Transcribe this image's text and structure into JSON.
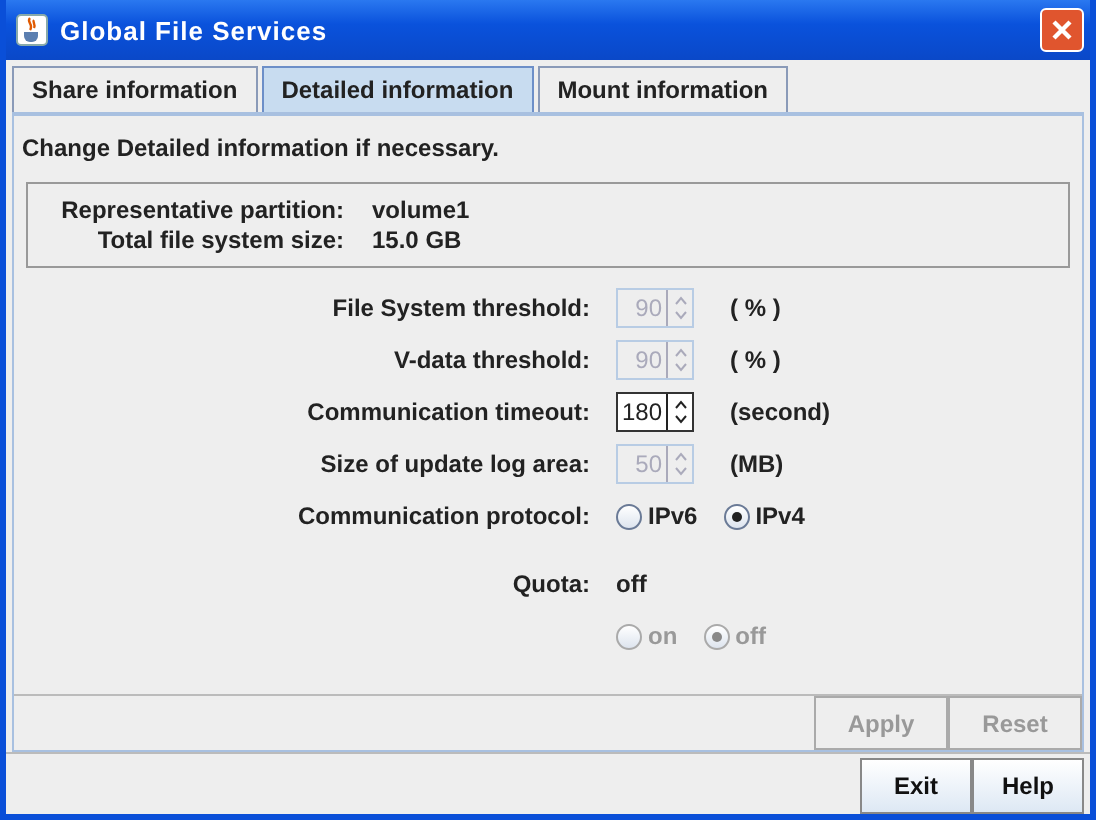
{
  "window": {
    "title": "Global File Services"
  },
  "tabs": [
    {
      "label": "Share information",
      "selected": false
    },
    {
      "label": "Detailed information",
      "selected": true
    },
    {
      "label": "Mount information",
      "selected": false
    }
  ],
  "instruction": "Change Detailed information if necessary.",
  "summary": [
    {
      "label": "Representative partition:",
      "value": "volume1"
    },
    {
      "label": "Total file system size:",
      "value": "15.0 GB"
    }
  ],
  "settings": [
    {
      "kind": "spinner",
      "label": "File System threshold:",
      "value": "90",
      "unit": "( % )",
      "disabled": true
    },
    {
      "kind": "spinner",
      "label": "V-data threshold:",
      "value": "90",
      "unit": "( % )",
      "disabled": true
    },
    {
      "kind": "spinner",
      "label": "Communication timeout:",
      "value": "180",
      "unit": "(second)",
      "disabled": false
    },
    {
      "kind": "spinner",
      "label": "Size of update log area:",
      "value": "50",
      "unit": "(MB)",
      "disabled": true
    },
    {
      "kind": "radio",
      "label": "Communication protocol:",
      "disabled": false,
      "options": [
        {
          "label": "IPv6",
          "selected": false
        },
        {
          "label": "IPv4",
          "selected": true
        }
      ]
    },
    {
      "kind": "text",
      "label": "Quota:",
      "value": "off"
    },
    {
      "kind": "radio",
      "disabled": true,
      "options": [
        {
          "label": "on",
          "selected": false
        },
        {
          "label": "off",
          "selected": true
        }
      ]
    }
  ],
  "panel_buttons": [
    {
      "label": "Apply",
      "disabled": true
    },
    {
      "label": "Reset",
      "disabled": true
    }
  ],
  "footer_buttons": [
    {
      "label": "Exit"
    },
    {
      "label": "Help"
    }
  ]
}
